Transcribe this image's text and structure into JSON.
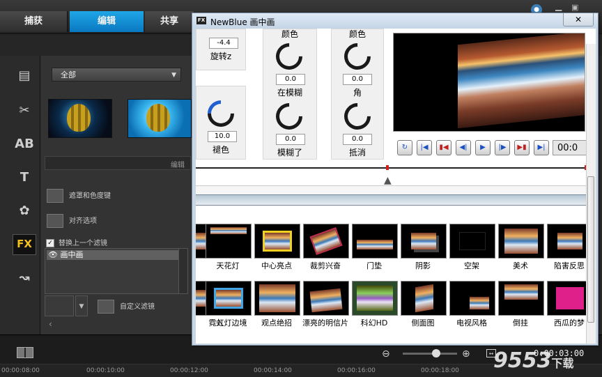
{
  "app": {
    "tabs": [
      "捕获",
      "编辑",
      "共享"
    ],
    "active_tab": "编辑"
  },
  "library": {
    "dropdown_value": "全部",
    "search_label": "编辑",
    "options": [
      "遮罩和色度键",
      "对齐选项"
    ],
    "checkbox_label": "替换上一个滤镜",
    "checkbox_checked": true,
    "selected_filter": "画中画",
    "custom_filter_label": "自定义滤镜"
  },
  "side_icons": [
    "media-icon",
    "instant-project-icon",
    "transition-icon",
    "title-icon",
    "graphics-icon",
    "fx-icon",
    "path-icon"
  ],
  "fx_icon_label": "FX",
  "dialog": {
    "title": "NewBlue 画中画",
    "close": "✕",
    "fx_badge": "FX"
  },
  "controls": {
    "top_left": {
      "value": "-4.4",
      "label": "旋转z"
    },
    "col2_top_label": "颜色",
    "col3_top_label": "颜色",
    "knob_blur_in": {
      "value": "0.0",
      "label": "在模糊"
    },
    "knob_angle": {
      "value": "0.0",
      "label": "角"
    },
    "knob_fade": {
      "value": "10.0",
      "label": "褪色"
    },
    "knob_blur": {
      "value": "0.0",
      "label": "模糊了"
    },
    "knob_offset": {
      "value": "0.0",
      "label": "抵消"
    }
  },
  "preview": {
    "time": "00:0"
  },
  "preset_row1": [
    "",
    "天花灯",
    "中心亮点",
    "裁剪兴奋",
    "门垫",
    "阴影",
    "空架",
    "美术",
    "陷害反思"
  ],
  "preset_row2": [
    "入",
    "霓虹灯边境",
    "观点绝招",
    "漂亮的明信片",
    "科幻HD",
    "侧面图",
    "电视风格",
    "倒挂",
    "西瓜的梦"
  ],
  "timeline": {
    "time": "0:00:03:00",
    "ticks": [
      "00:00:08:00",
      "00:00:10:00",
      "00:00:12:00",
      "00:00:14:00",
      "00:00:16:00",
      "00:00:18:00"
    ]
  },
  "watermark": {
    "text": "9553",
    "suffix": "下载"
  },
  "colors": {
    "accent": "#0a8bd6",
    "fx": "#f0c020"
  }
}
